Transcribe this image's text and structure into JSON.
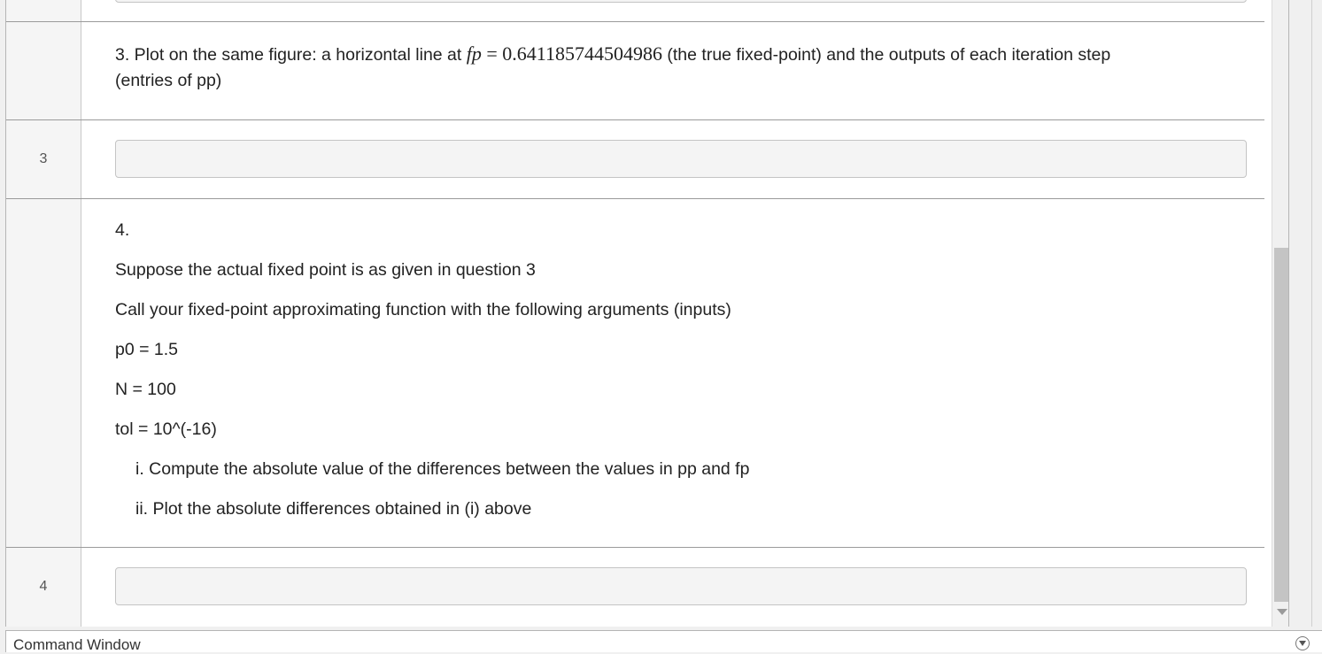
{
  "editor": {
    "section3": {
      "text_before": "3. Plot on the same figure: a horizontal line at",
      "math_var": "fp",
      "math_rest": " = 0.641185744504986",
      "text_after": "(the true fixed-point) and the outputs of each iteration step",
      "line2": "(entries of pp)"
    },
    "code_line_3": {
      "number": "3",
      "code": ""
    },
    "section4": {
      "heading": "4.",
      "line1": "Suppose the actual fixed point is as given in question 3",
      "line2": "Call your fixed-point approximating function with the following arguments (inputs)",
      "line3": "p0 = 1.5",
      "line4": "N = 100",
      "line5": "tol = 10^(-16)",
      "item1": "i. Compute the absolute value of the differences between the values in pp and fp",
      "item2": "ii. Plot the absolute differences obtained in (i) above"
    },
    "code_line_4": {
      "number": "4",
      "code": ""
    }
  },
  "command_window": {
    "title": "Command Window",
    "menu_icon": "chevron-down-circle-icon"
  },
  "colors": {
    "code_box_bg": "#f4f4f4",
    "separator": "#9a9a9a",
    "gutter_bg": "#f5f5f5"
  }
}
